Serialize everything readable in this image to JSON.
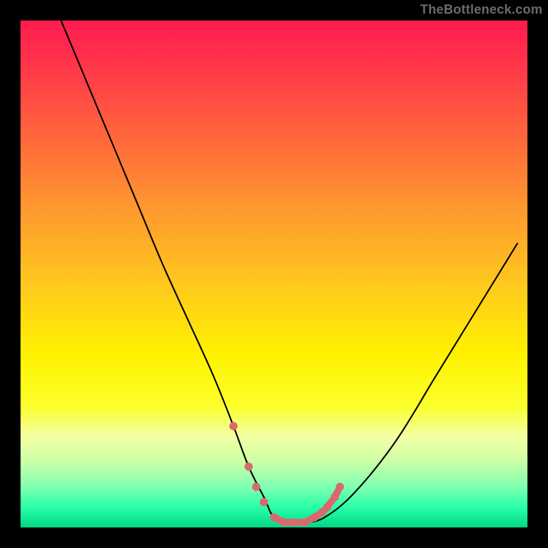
{
  "watermark": "TheBottleneck.com",
  "colors": {
    "frame": "#000000",
    "watermark": "#6a6a6a",
    "curve": "#000000",
    "marker": "#d86a6e",
    "gradient_top": "#ff1b4f",
    "gradient_mid": "#fff200",
    "gradient_bottom": "#00d884"
  },
  "chart_data": {
    "type": "line",
    "title": "",
    "xlabel": "",
    "ylabel": "",
    "xlim": [
      0,
      100
    ],
    "ylim": [
      0,
      100
    ],
    "grid": false,
    "legend": false,
    "annotations": [
      "TheBottleneck.com"
    ],
    "series": [
      {
        "name": "bottleneck-curve",
        "x": [
          8,
          13,
          18,
          23,
          28,
          33,
          38,
          42,
          45,
          48,
          50,
          53,
          56,
          60,
          66,
          74,
          82,
          90,
          98
        ],
        "values": [
          100,
          88,
          76,
          64,
          52,
          41,
          30,
          20,
          12,
          6,
          2,
          1,
          1,
          2,
          7,
          17,
          30,
          43,
          56
        ]
      }
    ],
    "markers": {
      "name": "highlight-dots",
      "color": "#d86a6e",
      "points": [
        {
          "x": 42,
          "y": 20
        },
        {
          "x": 45,
          "y": 12
        },
        {
          "x": 46.5,
          "y": 8
        },
        {
          "x": 48,
          "y": 5
        },
        {
          "x": 50,
          "y": 2
        },
        {
          "x": 52,
          "y": 1
        },
        {
          "x": 54,
          "y": 1
        },
        {
          "x": 56,
          "y": 1
        },
        {
          "x": 58,
          "y": 2
        },
        {
          "x": 59.5,
          "y": 3
        },
        {
          "x": 60.5,
          "y": 4
        },
        {
          "x": 62,
          "y": 6
        },
        {
          "x": 63,
          "y": 8
        }
      ]
    }
  }
}
